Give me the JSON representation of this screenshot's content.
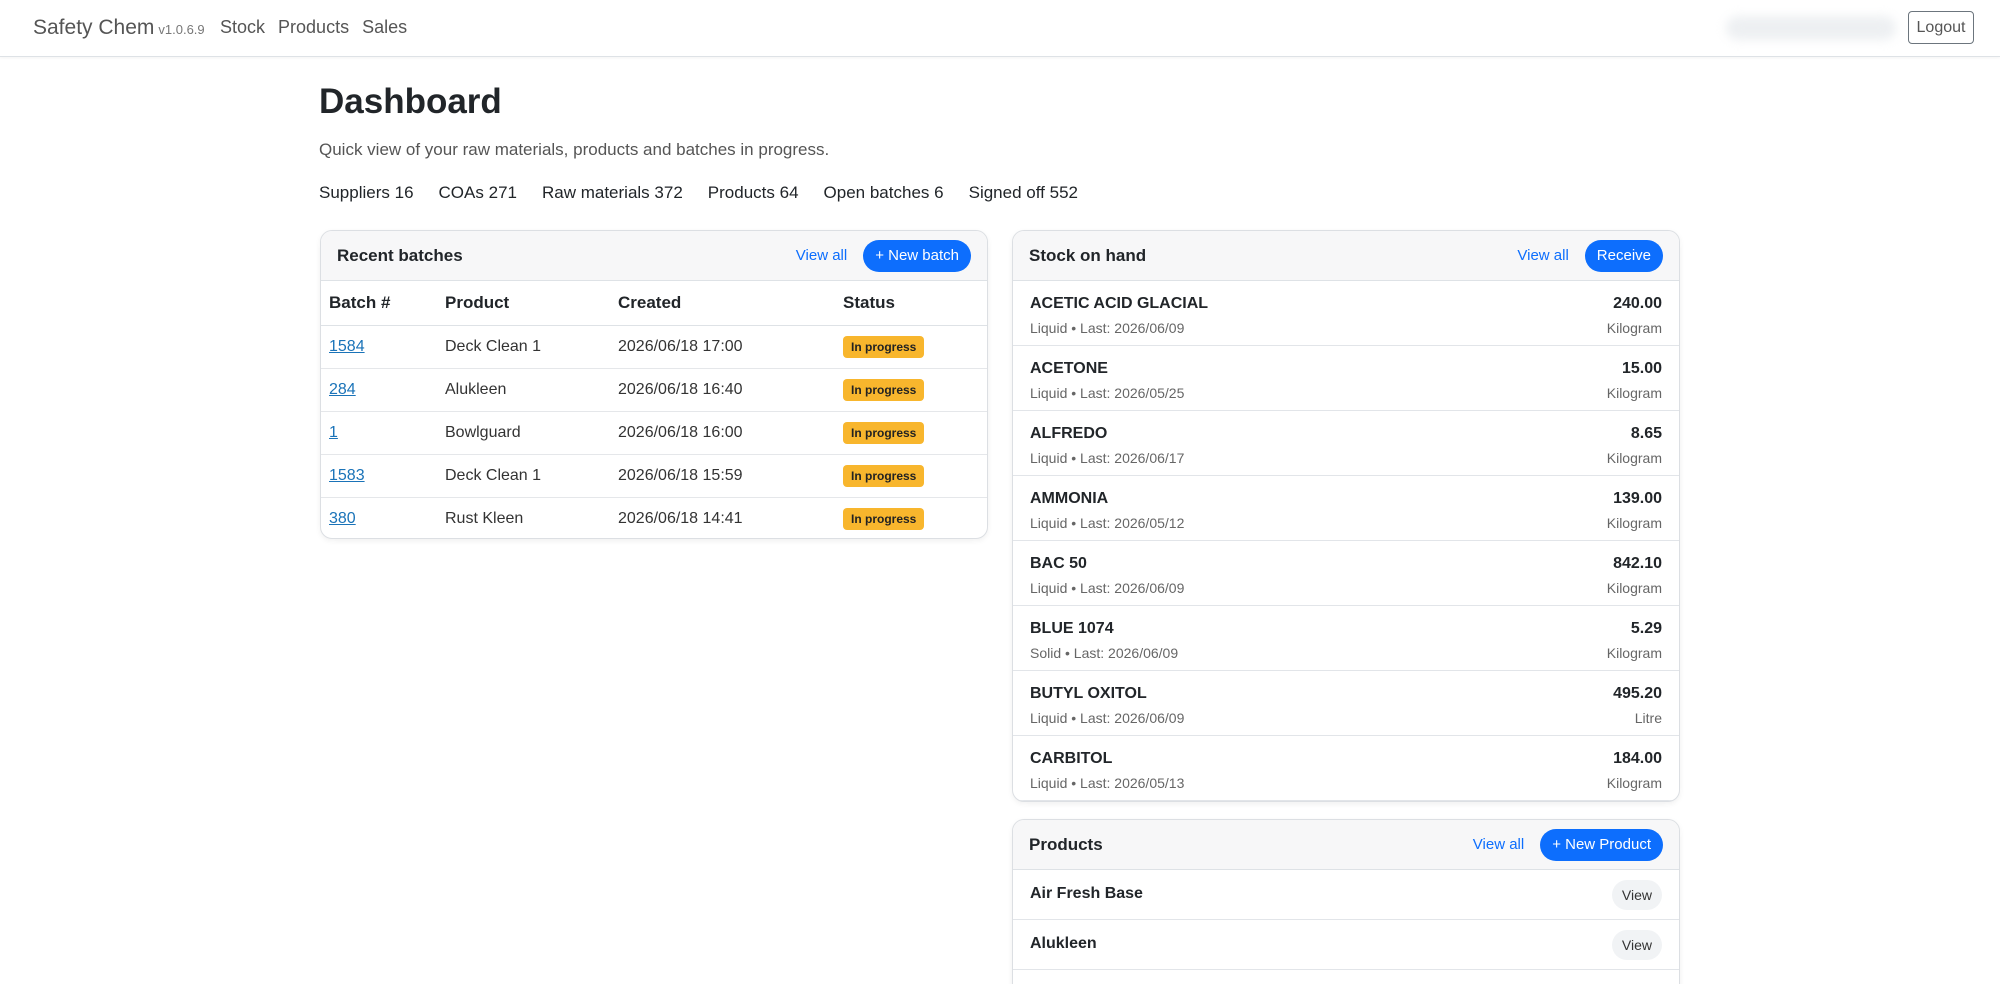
{
  "nav": {
    "brand": "Safety Chem",
    "version": "v1.0.6.9",
    "links": [
      "Stock",
      "Products",
      "Sales"
    ],
    "logout": "Logout"
  },
  "header": {
    "title": "Dashboard",
    "subtitle": "Quick view of your raw materials, products and batches in progress.",
    "stats": [
      {
        "label": "Suppliers",
        "value": "16"
      },
      {
        "label": "COAs",
        "value": "271"
      },
      {
        "label": "Raw materials",
        "value": "372"
      },
      {
        "label": "Products",
        "value": "64"
      },
      {
        "label": "Open batches",
        "value": "6"
      },
      {
        "label": "Signed off",
        "value": "552"
      }
    ]
  },
  "batches": {
    "title": "Recent batches",
    "view_all": "View all",
    "new_button": "+ New batch",
    "columns": [
      "Batch #",
      "Product",
      "Created",
      "Status"
    ],
    "rows": [
      {
        "batch": "1584",
        "product": "Deck Clean 1",
        "created": "2026/06/18 17:00",
        "status": "In progress"
      },
      {
        "batch": "284",
        "product": "Alukleen",
        "created": "2026/06/18 16:40",
        "status": "In progress"
      },
      {
        "batch": "1",
        "product": "Bowlguard",
        "created": "2026/06/18 16:00",
        "status": "In progress"
      },
      {
        "batch": "1583",
        "product": "Deck Clean 1",
        "created": "2026/06/18 15:59",
        "status": "In progress"
      },
      {
        "batch": "380",
        "product": "Rust Kleen",
        "created": "2026/06/18 14:41",
        "status": "In progress"
      }
    ]
  },
  "stock": {
    "title": "Stock on hand",
    "view_all": "View all",
    "receive_button": "Receive",
    "items": [
      {
        "name": "ACETIC ACID GLACIAL",
        "sub": "Liquid • Last: 2026/06/09",
        "qty": "240.00",
        "unit": "Kilogram"
      },
      {
        "name": "ACETONE",
        "sub": "Liquid • Last: 2026/05/25",
        "qty": "15.00",
        "unit": "Kilogram"
      },
      {
        "name": "ALFREDO",
        "sub": "Liquid • Last: 2026/06/17",
        "qty": "8.65",
        "unit": "Kilogram"
      },
      {
        "name": "AMMONIA",
        "sub": "Liquid • Last: 2026/05/12",
        "qty": "139.00",
        "unit": "Kilogram"
      },
      {
        "name": "BAC 50",
        "sub": "Liquid • Last: 2026/06/09",
        "qty": "842.10",
        "unit": "Kilogram"
      },
      {
        "name": "BLUE 1074",
        "sub": "Solid • Last: 2026/06/09",
        "qty": "5.29",
        "unit": "Kilogram"
      },
      {
        "name": "BUTYL OXITOL",
        "sub": "Liquid • Last: 2026/06/09",
        "qty": "495.20",
        "unit": "Litre"
      },
      {
        "name": "CARBITOL",
        "sub": "Liquid • Last: 2026/05/13",
        "qty": "184.00",
        "unit": "Kilogram"
      }
    ]
  },
  "products": {
    "title": "Products",
    "view_all": "View all",
    "new_button": "+ New Product",
    "view_label": "View",
    "items": [
      "Air Fresh Base",
      "Alukleen"
    ]
  }
}
